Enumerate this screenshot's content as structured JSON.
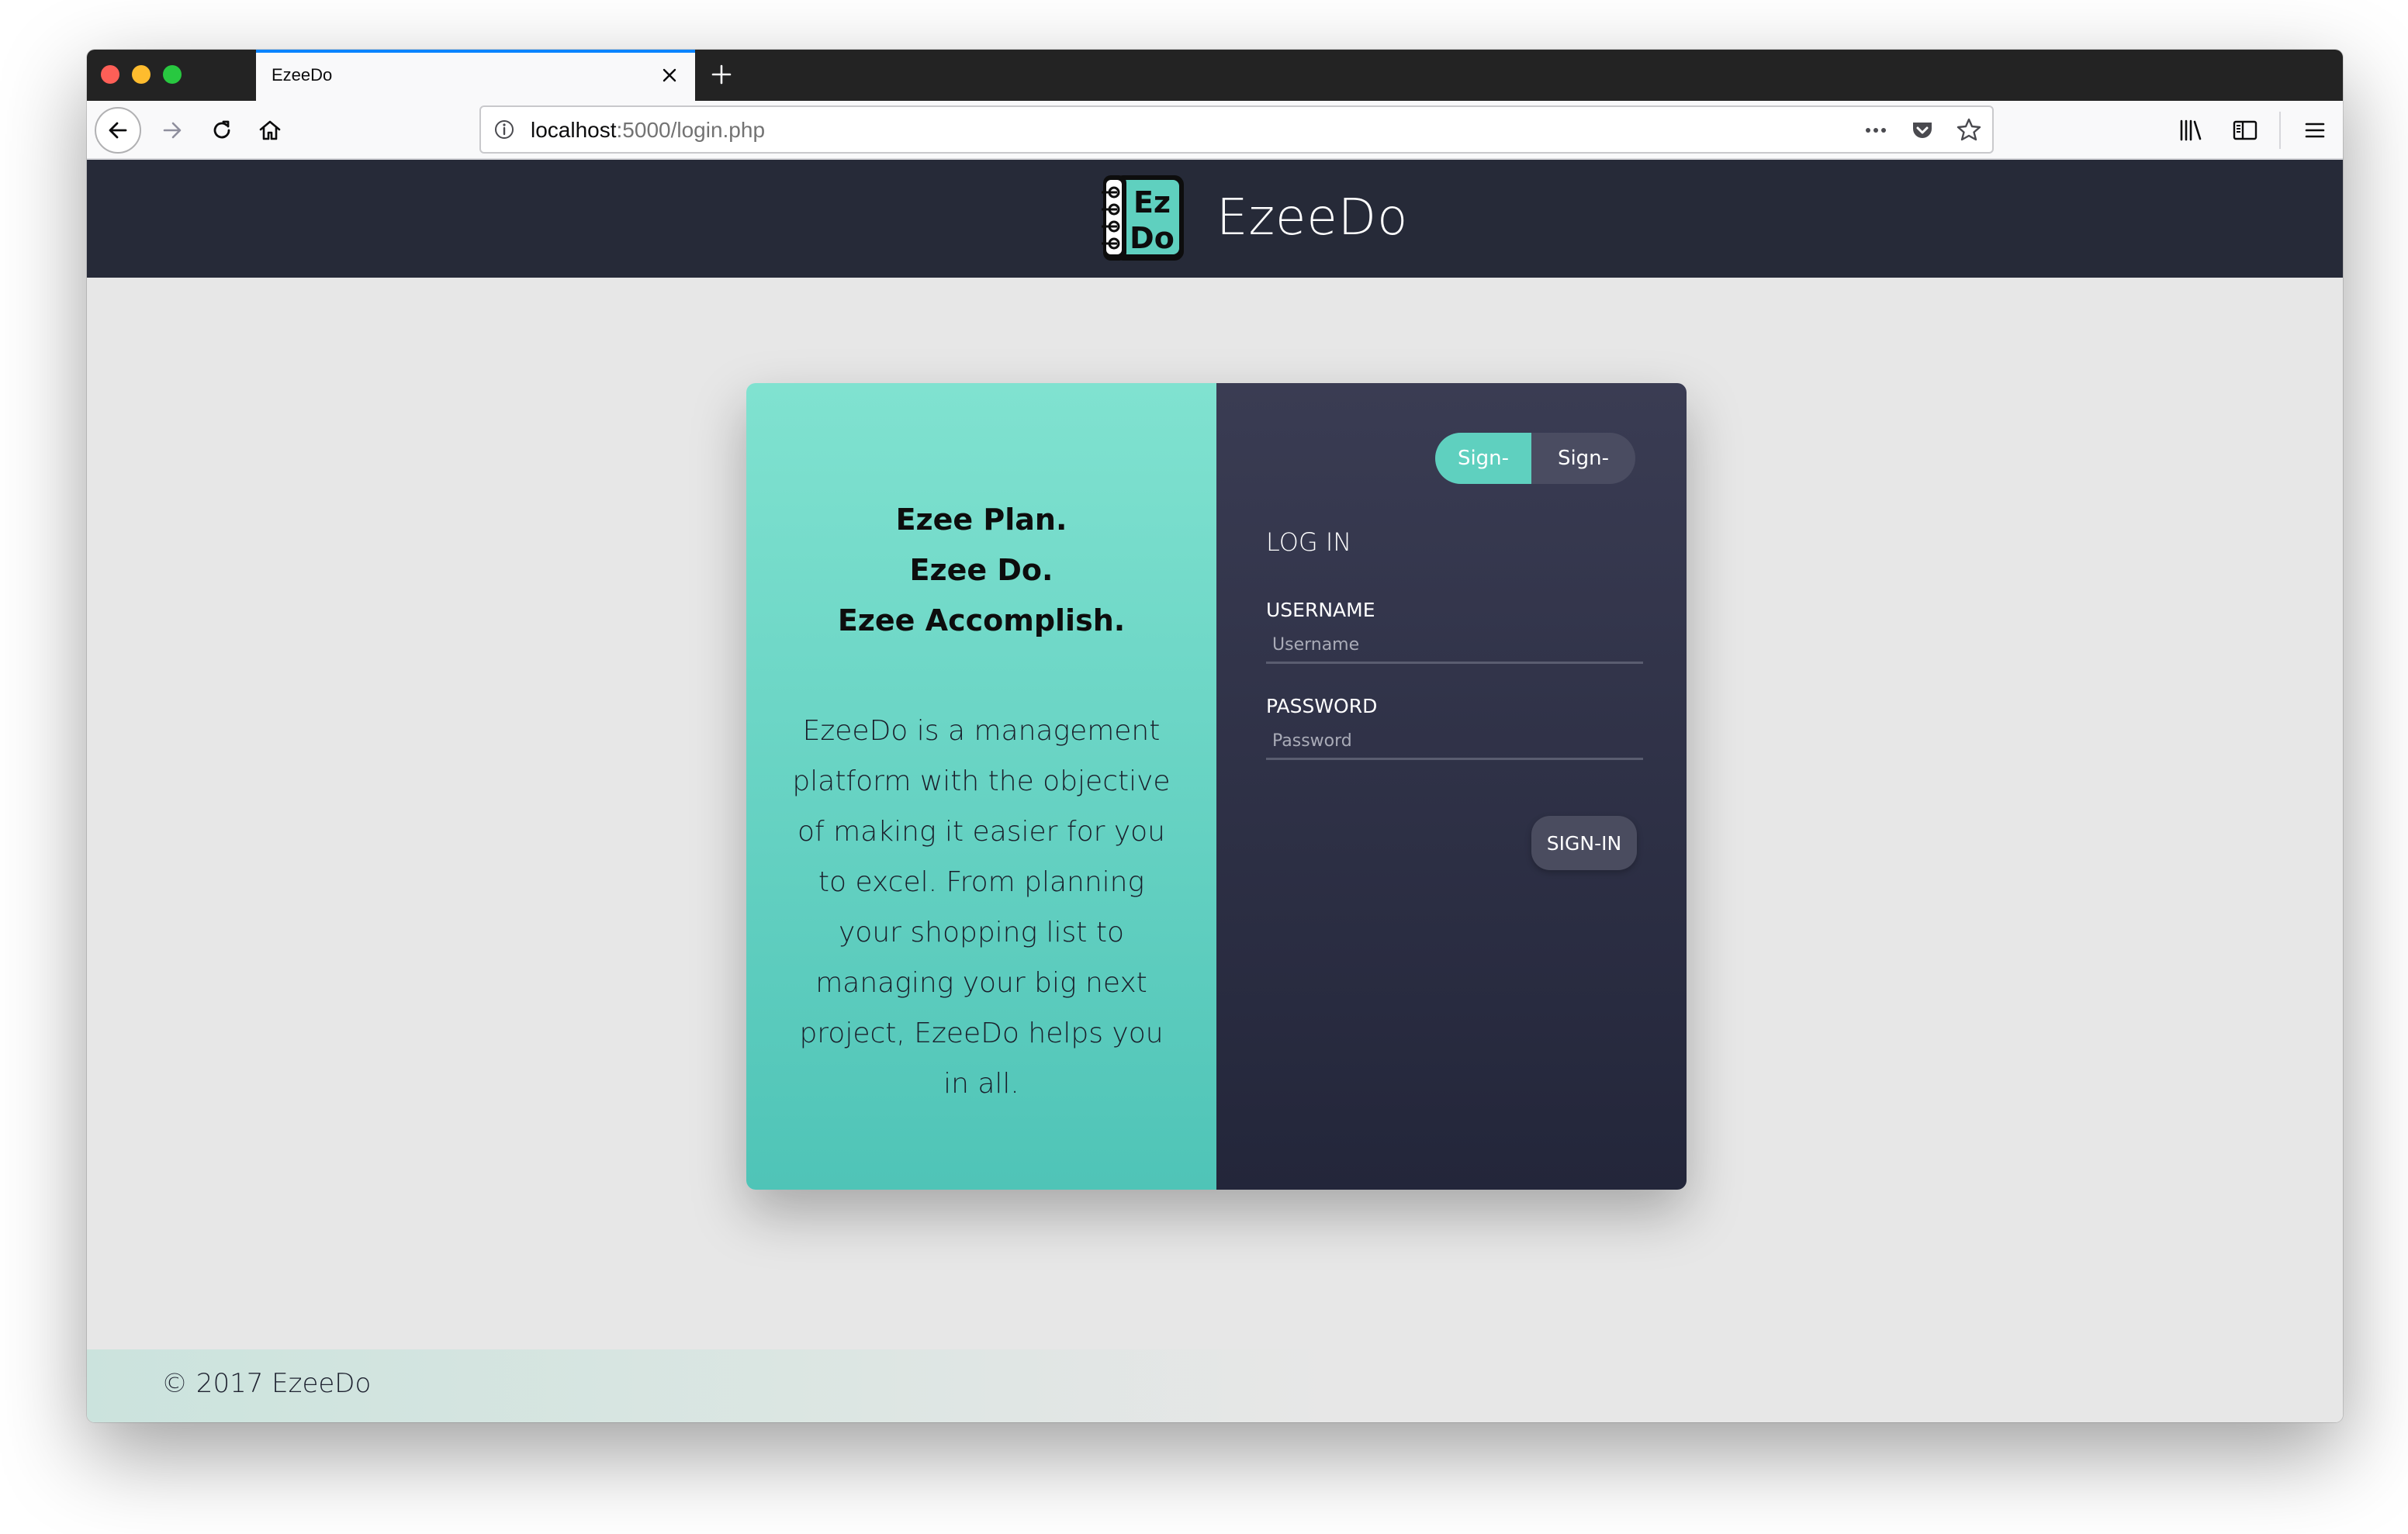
{
  "browser": {
    "tab_title": "EzeeDo",
    "url_host": "localhost",
    "url_path": ":5000/login.php",
    "icons": {
      "back": "back-arrow-icon",
      "forward": "forward-arrow-icon",
      "reload": "reload-icon",
      "home": "home-icon",
      "info": "info-icon",
      "more": "more-actions-icon",
      "pocket": "pocket-icon",
      "bookmark": "bookmark-star-icon",
      "library": "library-icon",
      "sidebar": "sidebar-icon",
      "menu": "hamburger-menu-icon"
    }
  },
  "site": {
    "brand_name": "EzeeDo",
    "logo_text_top": "Ez",
    "logo_text_bottom": "Do"
  },
  "hero": {
    "tagline": [
      "Ezee Plan.",
      "Ezee Do.",
      "Ezee Accomplish."
    ],
    "description": "EzeeDo is a management platform with the objective of making it easier for you to excel. From planning your shopping list to managing your big next project, EzeeDo helps you in all."
  },
  "auth": {
    "toggle_signin": "Sign-in",
    "toggle_signup": "Sign-up",
    "heading": "LOG IN",
    "username_label": "USERNAME",
    "username_placeholder": "Username",
    "password_label": "PASSWORD",
    "password_placeholder": "Password",
    "submit_label": "SIGN-IN"
  },
  "footer": {
    "text": "© 2017 EzeeDo"
  },
  "colors": {
    "header_bg": "#262a38",
    "accent": "#5fd0bf",
    "panel_dark": "#2c2f44",
    "page_bg": "#e7e7e7"
  }
}
